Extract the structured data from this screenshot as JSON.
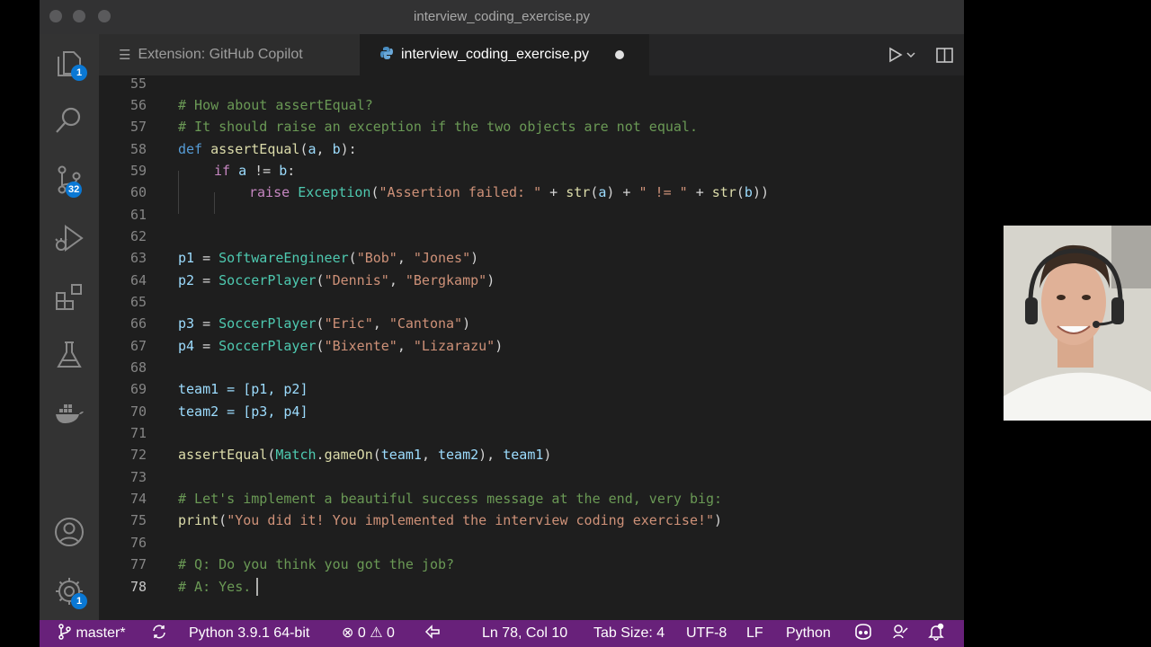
{
  "window": {
    "title": "interview_coding_exercise.py"
  },
  "activity_bar": {
    "explorer_badge": "1",
    "source_control_badge": "32",
    "settings_badge": "1"
  },
  "tabs": [
    {
      "label": "Extension: GitHub Copilot",
      "active": false
    },
    {
      "label": "interview_coding_exercise.py",
      "active": true,
      "dirty": true
    }
  ],
  "editor": {
    "lines": [
      {
        "n": "55"
      },
      {
        "n": "56",
        "text": "# How about assertEqual?"
      },
      {
        "n": "57",
        "text": "# It should raise an exception if the two objects are not equal."
      },
      {
        "n": "58",
        "text": "def assertEqual(a, b):"
      },
      {
        "n": "59",
        "text": "if a != b:"
      },
      {
        "n": "60",
        "text": "raise Exception(\"Assertion failed: \" + str(a) + \" != \" + str(b))"
      },
      {
        "n": "61"
      },
      {
        "n": "62"
      },
      {
        "n": "63",
        "text": "p1 = SoftwareEngineer(\"Bob\", \"Jones\")"
      },
      {
        "n": "64",
        "text": "p2 = SoccerPlayer(\"Dennis\", \"Bergkamp\")"
      },
      {
        "n": "65"
      },
      {
        "n": "66",
        "text": "p3 = SoccerPlayer(\"Eric\", \"Cantona\")"
      },
      {
        "n": "67",
        "text": "p4 = SoccerPlayer(\"Bixente\", \"Lizarazu\")"
      },
      {
        "n": "68"
      },
      {
        "n": "69",
        "text": "team1 = [p1, p2]"
      },
      {
        "n": "70",
        "text": "team2 = [p3, p4]"
      },
      {
        "n": "71"
      },
      {
        "n": "72",
        "text": "assertEqual(Match.gameOn(team1, team2), team1)"
      },
      {
        "n": "73"
      },
      {
        "n": "74",
        "text": "# Let's implement a beautiful success message at the end, very big:"
      },
      {
        "n": "75",
        "text": "print(\"You did it! You implemented the interview coding exercise!\")"
      },
      {
        "n": "76"
      },
      {
        "n": "77",
        "text": "# Q: Do you think you got the job?"
      },
      {
        "n": "78",
        "text": "# A: Yes."
      }
    ]
  },
  "statusbar": {
    "branch": "master*",
    "interpreter": "Python 3.9.1 64-bit",
    "errors": "0",
    "warnings": "0",
    "cursor_position": "Ln 78, Col 10",
    "tab_size": "Tab Size: 4",
    "encoding": "UTF-8",
    "line_ending": "LF",
    "language": "Python"
  },
  "colors": {
    "statusbar": "#68217a",
    "editor_bg": "#1e1e1e",
    "badge": "#0a78d4"
  }
}
